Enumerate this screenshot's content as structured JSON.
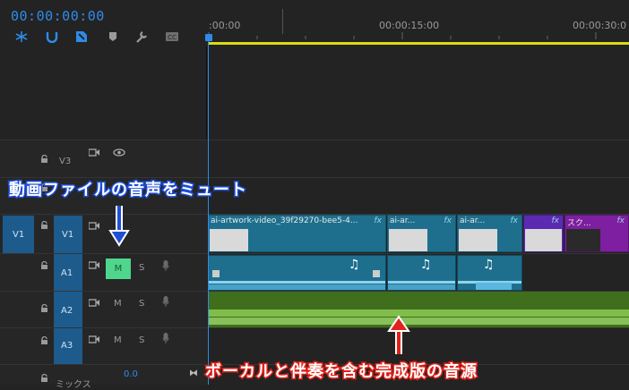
{
  "header": {
    "timecode": "00:00:00:00",
    "tools": [
      "snap-icon",
      "magnet-icon",
      "add-marker-icon",
      "marker-icon",
      "wrench-icon",
      "captions-icon"
    ]
  },
  "ruler": {
    "labels": [
      ":00:00",
      "00:00:15:00",
      "00:00:30:0"
    ]
  },
  "tracks": {
    "v3": {
      "label": "V3"
    },
    "v2_source": {
      "label": ""
    },
    "v1_source": {
      "label": "V1"
    },
    "v1": {
      "label": "V1"
    },
    "a1": {
      "label": "A1",
      "mute": "M",
      "solo": "S"
    },
    "a2": {
      "label": "A2",
      "mute": "M",
      "solo": "S"
    },
    "a3": {
      "label": "A3",
      "mute": "M",
      "solo": "S"
    },
    "mix": {
      "label": "ミックス",
      "value": "0.0"
    }
  },
  "clips": {
    "v1_clip1": "ai-artwork-video_39f29270-bee5-4...",
    "v1_clip2": "ai-ar...",
    "v1_clip3": "ai-ar...",
    "v1_clip5": "スク...",
    "fx": "fx"
  },
  "annotations": {
    "top": "動画ファイルの音声をミュート",
    "bottom": "ボーカルと伴奏を含む完成版の音源",
    "color_blue": "#1e4fd8",
    "color_red": "#e0231b"
  },
  "colors": {
    "accent": "#2d8ceb",
    "clip_blue": "#1e6f8e",
    "clip_purple": "#5b2ab0",
    "clip_magenta": "#7d1fa0",
    "audio_green": "#3f6e1c",
    "mute_active": "#4ed68c"
  }
}
